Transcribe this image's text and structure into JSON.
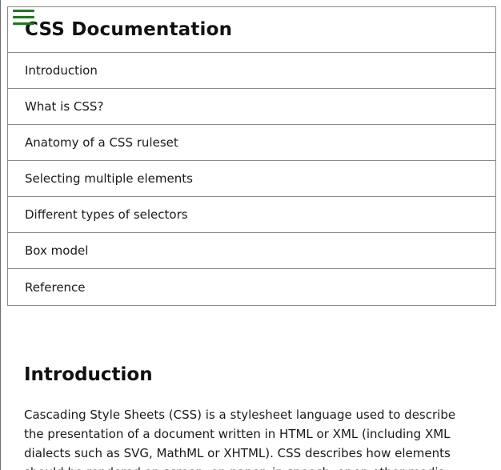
{
  "nav": {
    "menu_icon": "hamburger-menu-icon",
    "title": "CSS Documentation",
    "items": [
      {
        "label": "Introduction"
      },
      {
        "label": "What is CSS?"
      },
      {
        "label": "Anatomy of a CSS ruleset"
      },
      {
        "label": "Selecting multiple elements"
      },
      {
        "label": "Different types of selectors"
      },
      {
        "label": "Box model"
      },
      {
        "label": "Reference"
      }
    ]
  },
  "main": {
    "section": {
      "heading": "Introduction",
      "text": "Cascading Style Sheets (CSS) is a stylesheet language used to describe the presentation of a document written in HTML or XML (including XML dialects such as SVG, MathML or XHTML). CSS describes how elements should be rendered on screen, on paper, in speech, or on other media."
    }
  },
  "colors": {
    "menu_icon": "#1a7a1a",
    "border": "#8a8a8a",
    "text": "#111111"
  }
}
